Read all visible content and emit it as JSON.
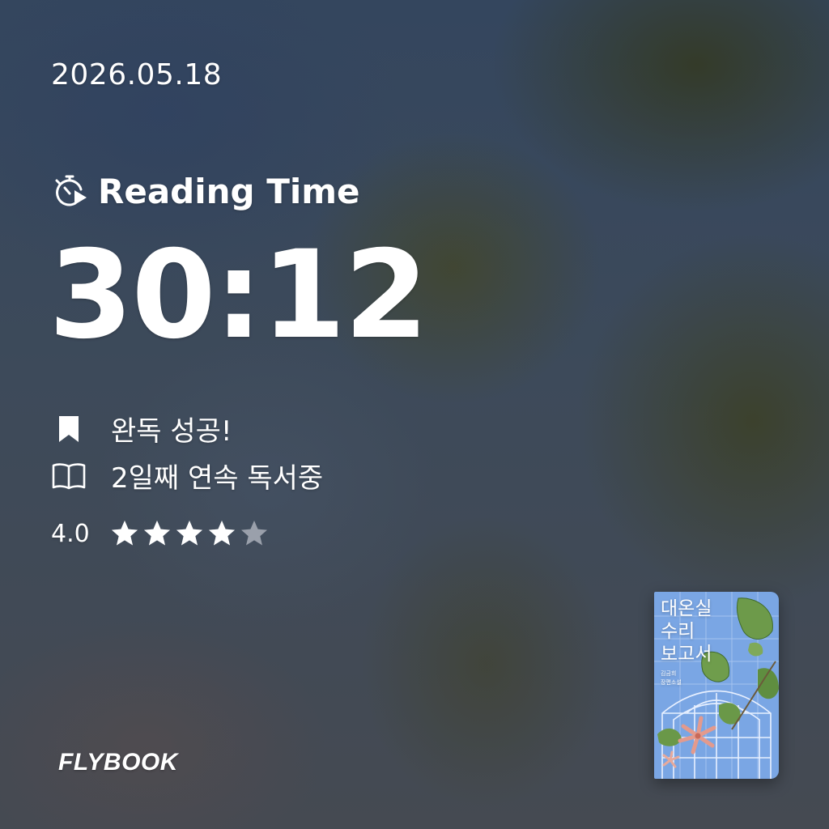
{
  "date": "2026.05.18",
  "reading": {
    "label": "Reading Time",
    "icon": "stopwatch-play-icon",
    "time": "30:12"
  },
  "stats": [
    {
      "icon": "bookmark-icon",
      "text": "완독 성공!"
    },
    {
      "icon": "open-book-icon",
      "text": "2일째 연속 독서중"
    }
  ],
  "rating": {
    "value_text": "4.0",
    "value": 4.0,
    "max": 5
  },
  "brand": {
    "name": "FLYBOOK"
  },
  "book": {
    "title_lines": [
      "대온실",
      "수리",
      "보고서"
    ],
    "author": "김금희",
    "subtitle": "장편소설"
  },
  "colors": {
    "text": "#ffffff",
    "star_filled": "#ffffff",
    "star_empty": "#9aa0ab",
    "cover_blue": "#7aa6e4"
  }
}
